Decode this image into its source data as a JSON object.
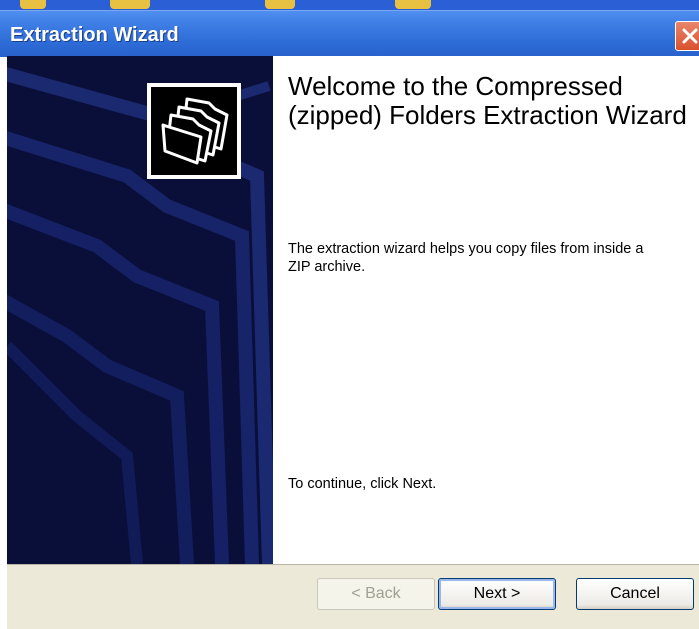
{
  "window": {
    "title": "Extraction Wizard"
  },
  "sidebar": {
    "icon": "zip-folder-icon"
  },
  "content": {
    "heading": "Welcome to the Compressed (zipped) Folders Extraction Wizard",
    "description": "The extraction wizard helps you copy files from inside a ZIP archive.",
    "continue_text": "To continue, click Next."
  },
  "buttons": {
    "back": "< Back",
    "next": "Next >",
    "cancel": "Cancel"
  },
  "colors": {
    "titlebar": "#2d6bd6",
    "sidebar": "#0a0f3a",
    "footer": "#ece9d8",
    "close": "#d9512f"
  }
}
